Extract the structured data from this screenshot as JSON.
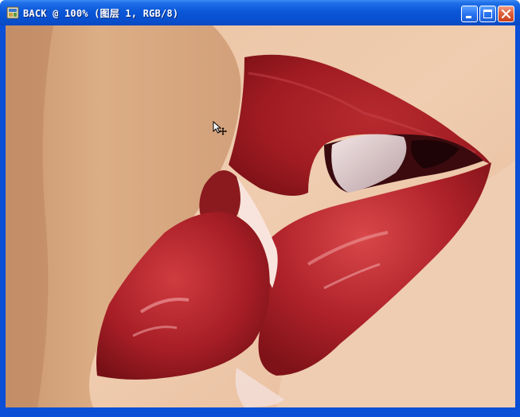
{
  "window": {
    "title": "BACK @ 100% (图层 1, RGB/8)",
    "title_bar_color": "#0a57d9"
  },
  "titlebar_buttons": {
    "minimize_icon": "minimize-icon",
    "maximize_icon": "maximize-icon",
    "close_icon": "close-icon"
  },
  "document": {
    "layer_name": "图层 1",
    "color_mode": "RGB/8",
    "zoom": "100%",
    "file_name": "BACK"
  },
  "colors": {
    "lip_red": "#b01c22",
    "skin": "#e8c0a0",
    "close_button": "#e0603c"
  }
}
